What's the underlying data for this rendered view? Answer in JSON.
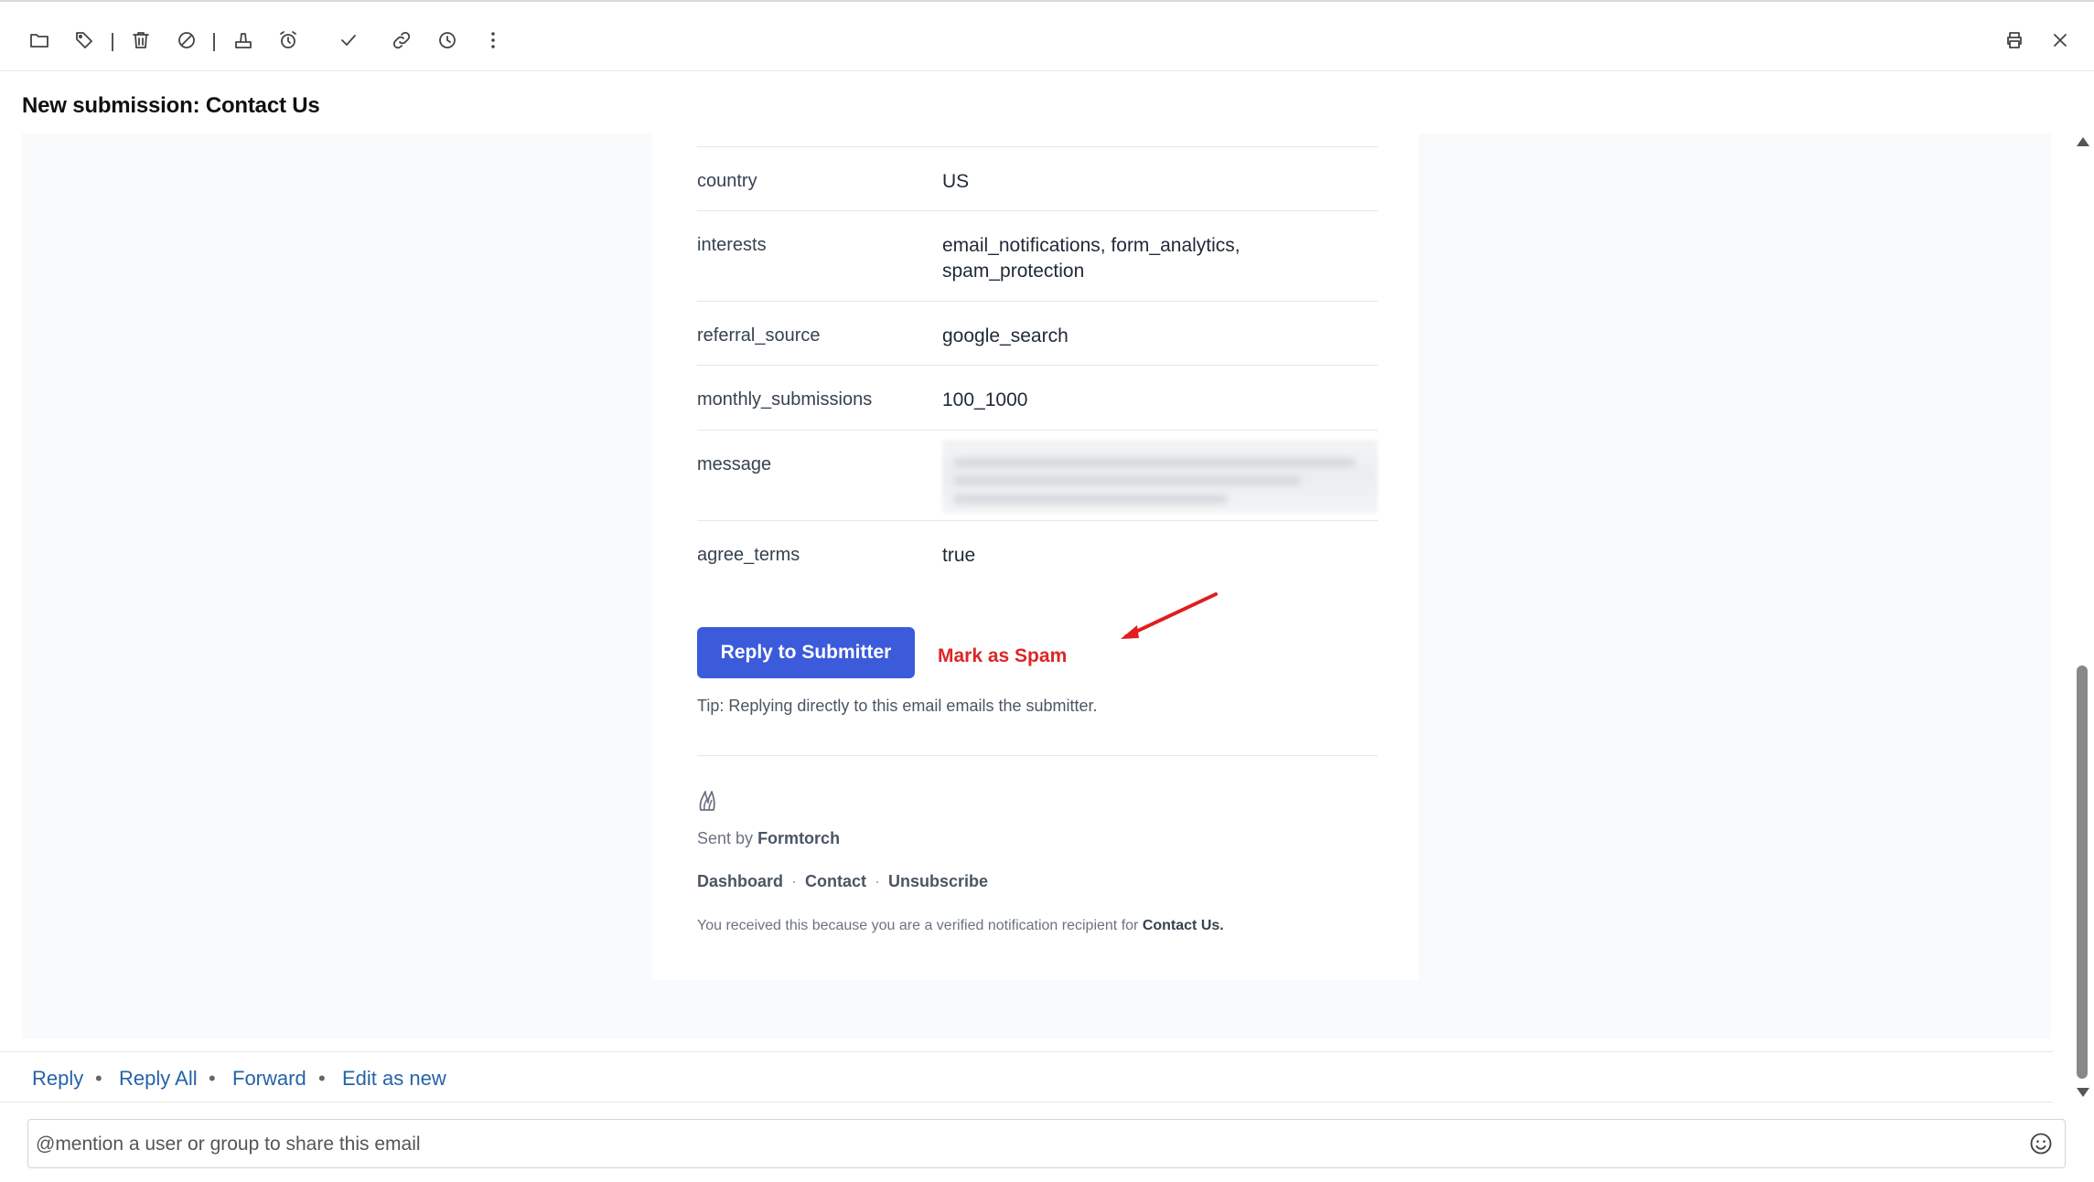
{
  "toolbar": {
    "left_icons": [
      "folder-icon",
      "tag-icon",
      "trash-icon",
      "block-icon",
      "archive-icon",
      "alarm-icon",
      "check-icon",
      "link-icon",
      "clock-icon",
      "more-icon"
    ],
    "right_icons": [
      "print-icon",
      "close-icon"
    ]
  },
  "subject": "New submission: Contact Us",
  "fields": [
    {
      "key": "country",
      "value": "US"
    },
    {
      "key": "interests",
      "value": "email_notifications, form_analytics, spam_protection"
    },
    {
      "key": "referral_source",
      "value": "google_search"
    },
    {
      "key": "monthly_submissions",
      "value": "100_1000"
    },
    {
      "key": "message",
      "value": ""
    },
    {
      "key": "agree_terms",
      "value": "true"
    }
  ],
  "cta": {
    "reply_label": "Reply to Submitter",
    "spam_label": "Mark as Spam",
    "tip": "Tip: Replying directly to this email emails the submitter."
  },
  "footer": {
    "sent_by_prefix": "Sent by",
    "brand": "Formtorch",
    "links": [
      "Dashboard",
      "Contact",
      "Unsubscribe"
    ],
    "notice_prefix": "You received this because you are a verified notification recipient for",
    "notice_form": "Contact Us."
  },
  "actions": [
    "Reply",
    "Reply All",
    "Forward",
    "Edit as new"
  ],
  "mention": {
    "placeholder": "@mention a user or group to share this email"
  },
  "colors": {
    "primary": "#3b5bdb",
    "spam": "#dc2626",
    "link": "#2563a8",
    "annotation_arrow": "#e11d1d"
  }
}
